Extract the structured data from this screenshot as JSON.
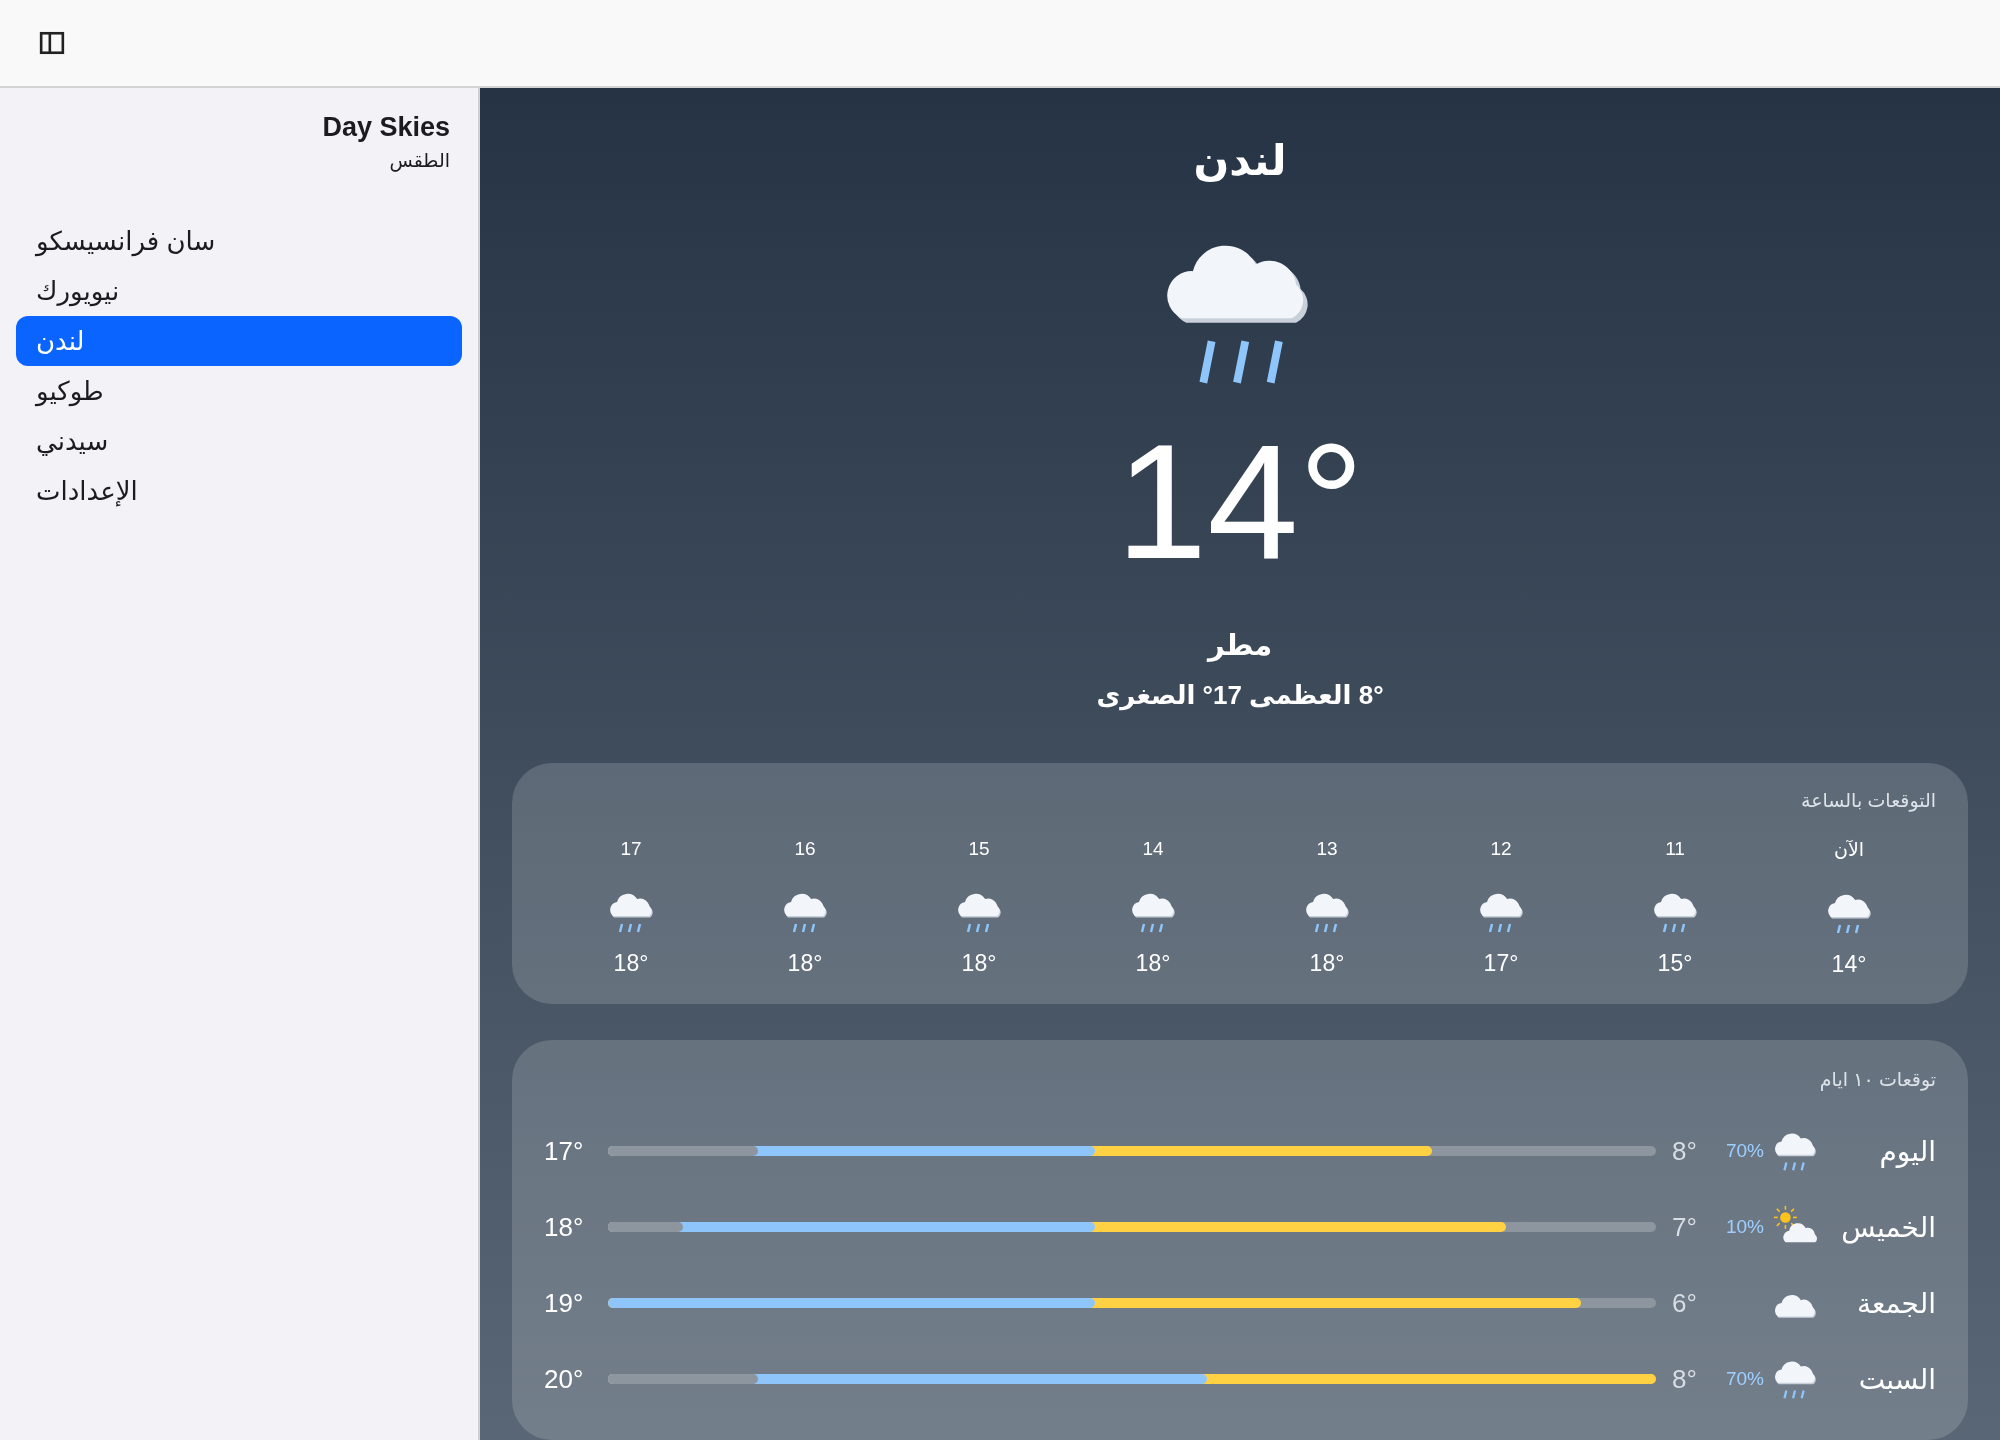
{
  "sidebar": {
    "title": "Day Skies",
    "subtitle": "الطقس",
    "items": [
      {
        "label": "سان فرانسيسكو",
        "selected": false
      },
      {
        "label": "نيويورك",
        "selected": false
      },
      {
        "label": "لندن",
        "selected": true
      },
      {
        "label": "طوكيو",
        "selected": false
      },
      {
        "label": "سيدني",
        "selected": false
      },
      {
        "label": "الإعدادات",
        "selected": false
      }
    ]
  },
  "current": {
    "city": "لندن",
    "kind": "rain",
    "temperature": "14°",
    "condition": "مطر",
    "high_low": "8° العظمى 17° الصغرى"
  },
  "hourly": {
    "title": "التوقعات بالساعة",
    "hours": [
      {
        "time": "الآن",
        "kind": "rain",
        "temp": "14°"
      },
      {
        "time": "11",
        "kind": "rain",
        "temp": "15°"
      },
      {
        "time": "12",
        "kind": "rain",
        "temp": "17°"
      },
      {
        "time": "13",
        "kind": "rain",
        "temp": "18°"
      },
      {
        "time": "14",
        "kind": "rain",
        "temp": "18°"
      },
      {
        "time": "15",
        "kind": "rain",
        "temp": "18°"
      },
      {
        "time": "16",
        "kind": "rain",
        "temp": "18°"
      },
      {
        "time": "17",
        "kind": "rain",
        "temp": "18°"
      }
    ]
  },
  "daily": {
    "title": "توقعات ١٠ ايام",
    "days": [
      {
        "day": "اليوم",
        "kind": "rain",
        "precip": "70%",
        "low": "8°",
        "high": "17°",
        "warm_fill": {
          "level": 0.786
        },
        "cool_fill": {
          "level": 0.465
        },
        "gap_fill": {
          "level": 0.143
        }
      },
      {
        "day": "الخميس",
        "kind": "partly-sunny",
        "precip": "10%",
        "low": "7°",
        "high": "18°",
        "warm_fill": {
          "level": 0.857
        },
        "cool_fill": {
          "level": 0.465
        },
        "gap_fill": {
          "level": 0.072
        }
      },
      {
        "day": "الجمعة",
        "kind": "cloudy",
        "low": "6°",
        "high": "19°",
        "warm_fill": {
          "level": 0.928
        },
        "cool_fill": {
          "level": 0.465
        }
      },
      {
        "day": "السبت",
        "kind": "rain",
        "precip": "70%",
        "low": "8°",
        "high": "20°",
        "warm_fill": {
          "level": 1.0
        },
        "cool_fill": {
          "level": 0.572
        },
        "gap_fill": {
          "level": 0.143
        }
      }
    ]
  }
}
